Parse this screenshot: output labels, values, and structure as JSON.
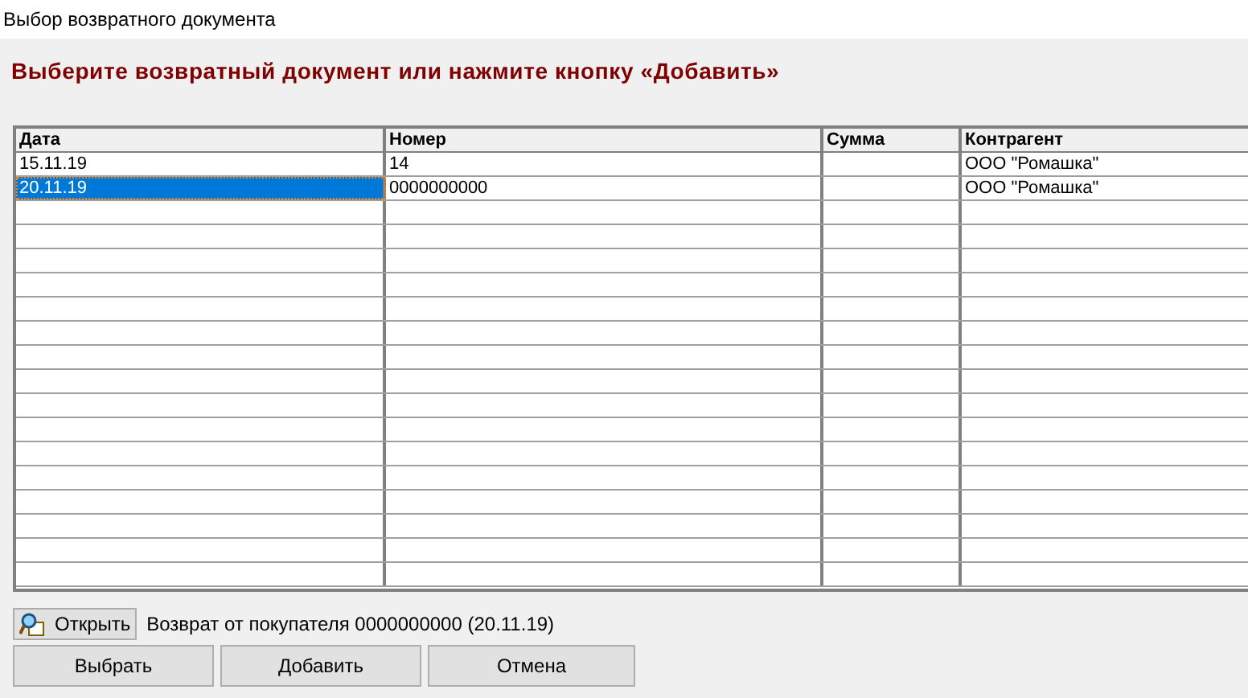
{
  "window": {
    "title": "Выбор возвратного документа"
  },
  "heading": "Выберите возвратный документ или нажмите кнопку «Добавить»",
  "table": {
    "columns": [
      "Дата",
      "Номер",
      "Сумма",
      "Контрагент"
    ],
    "rows": [
      {
        "cells": [
          "15.11.19",
          "14",
          "",
          "ООО \"Ромашка\""
        ],
        "selected": false
      },
      {
        "cells": [
          "20.11.19",
          "0000000000",
          "",
          "ООО \"Ромашка\""
        ],
        "selected": true
      }
    ]
  },
  "open_button": "Открыть",
  "document_info": "Возврат от покупателя 0000000000 (20.11.19)",
  "buttons": [
    "Выбрать",
    "Добавить",
    "Отмена"
  ]
}
